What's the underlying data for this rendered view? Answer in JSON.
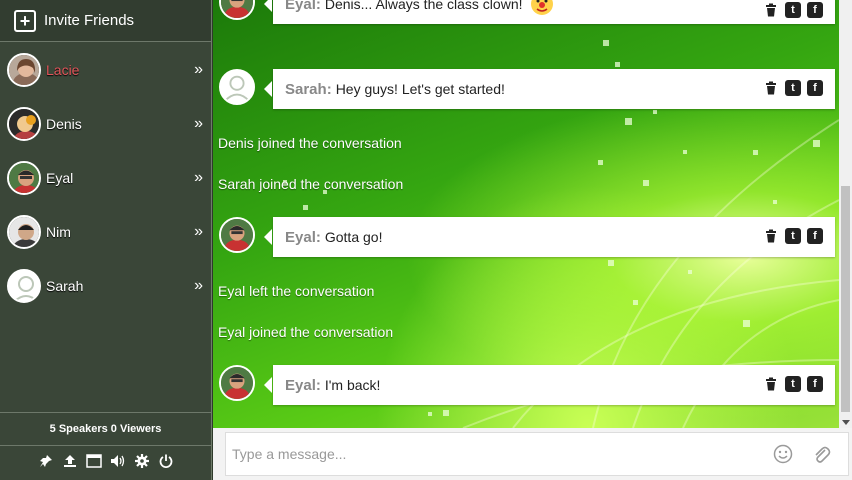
{
  "sidebar": {
    "invite_label": "Invite Friends",
    "users": [
      {
        "name": "Lacie",
        "active": true
      },
      {
        "name": "Denis",
        "active": false
      },
      {
        "name": "Eyal",
        "active": false
      },
      {
        "name": "Nim",
        "active": false
      },
      {
        "name": "Sarah",
        "active": false
      }
    ],
    "chevron": "»",
    "stats": "5 Speakers 0 Viewers",
    "toolbar_icons": [
      "pin-icon",
      "upload-icon",
      "window-icon",
      "speaker-icon",
      "gear-icon",
      "power-icon"
    ]
  },
  "messages": [
    {
      "kind": "message",
      "author": "Eyal:",
      "text": "Denis... Always the class clown!",
      "avatar": "eyal"
    },
    {
      "kind": "message",
      "author": "Sarah:",
      "text": "Hey guys! Let's get started!",
      "avatar": "default"
    },
    {
      "kind": "system",
      "text": "Denis joined the conversation"
    },
    {
      "kind": "system",
      "text": "Sarah joined the conversation"
    },
    {
      "kind": "message",
      "author": "Eyal:",
      "text": "Gotta go!",
      "avatar": "eyal"
    },
    {
      "kind": "system",
      "text": "Eyal left the conversation"
    },
    {
      "kind": "system",
      "text": "Eyal joined the conversation"
    },
    {
      "kind": "message",
      "author": "Eyal:",
      "text": "I'm back!",
      "avatar": "eyal"
    }
  ],
  "message_actions": [
    "trash-icon",
    "twitter-icon",
    "facebook-icon"
  ],
  "composer": {
    "placeholder": "Type a message..."
  },
  "colors": {
    "active_user": "#e0555a",
    "sidebar_bg": "#3a4638",
    "chat_green": "#35a611"
  }
}
